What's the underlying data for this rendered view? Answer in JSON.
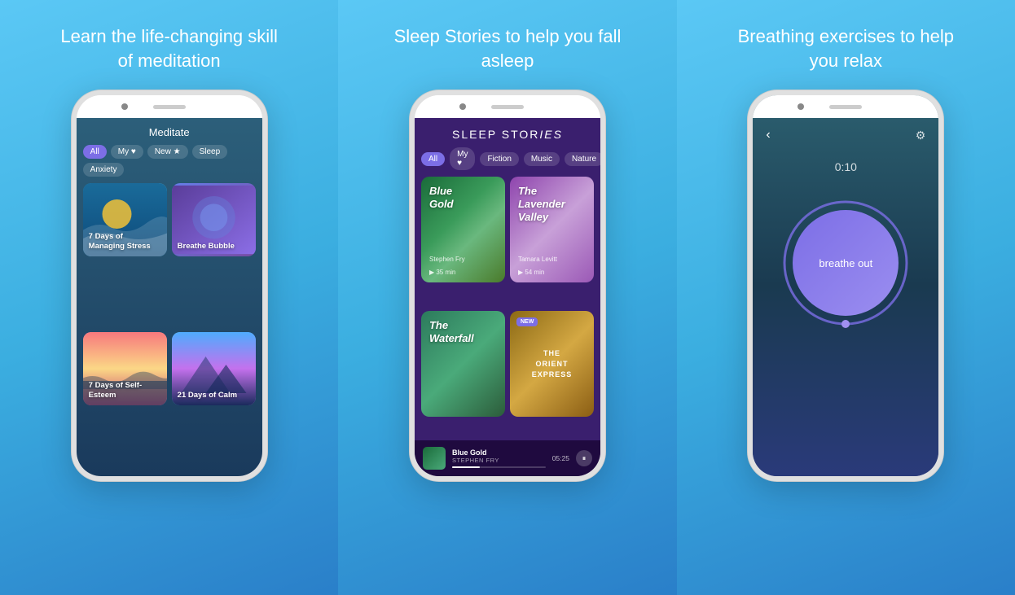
{
  "panels": [
    {
      "id": "left",
      "title": "Learn the life-changing skill of meditation",
      "phone": {
        "screen_title": "Meditate",
        "tabs": [
          {
            "label": "All",
            "active": true
          },
          {
            "label": "My ♥",
            "active": false
          },
          {
            "label": "New ★",
            "active": false
          },
          {
            "label": "Sleep",
            "active": false
          },
          {
            "label": "Anxiety",
            "active": false
          }
        ],
        "cards": [
          {
            "title": "7 Days of Managing Stress",
            "style": "ocean"
          },
          {
            "title": "Breathe Bubble",
            "style": "purple"
          },
          {
            "title": "7 Days of Self-Esteem",
            "style": "sunset"
          },
          {
            "title": "21 Days of Calm",
            "style": "mountain"
          }
        ]
      }
    },
    {
      "id": "center",
      "title": "Sleep Stories to help you fall asleep",
      "phone": {
        "header": "SLEEP STORIES",
        "tabs": [
          {
            "label": "All",
            "active": true
          },
          {
            "label": "My ♥",
            "active": false
          },
          {
            "label": "Fiction",
            "active": false
          },
          {
            "label": "Music",
            "active": false
          },
          {
            "label": "Nature",
            "active": false
          }
        ],
        "stories": [
          {
            "title": "Blue Gold",
            "author": "Stephen Fry",
            "duration": "▶ 35 min",
            "style": "blue-gold"
          },
          {
            "title": "The Lavender Valley",
            "author": "Tamara Levitt",
            "duration": "▶ 54 min",
            "style": "lavender"
          },
          {
            "title": "The Waterfall",
            "style": "waterfall"
          },
          {
            "title": "THE ORIENT EXPRESS",
            "style": "orient",
            "badge": "NEW"
          }
        ],
        "now_playing": {
          "title": "Blue Gold",
          "artist": "STEPHEN FRY",
          "time": "05:25"
        }
      }
    },
    {
      "id": "right",
      "title": "Breathing exercises to help you relax",
      "phone": {
        "timer": "0:10",
        "breathing_text": "breathe out"
      }
    }
  ],
  "icons": {
    "back": "‹",
    "settings": "⚙",
    "play": "▶",
    "pause": "⏸"
  }
}
